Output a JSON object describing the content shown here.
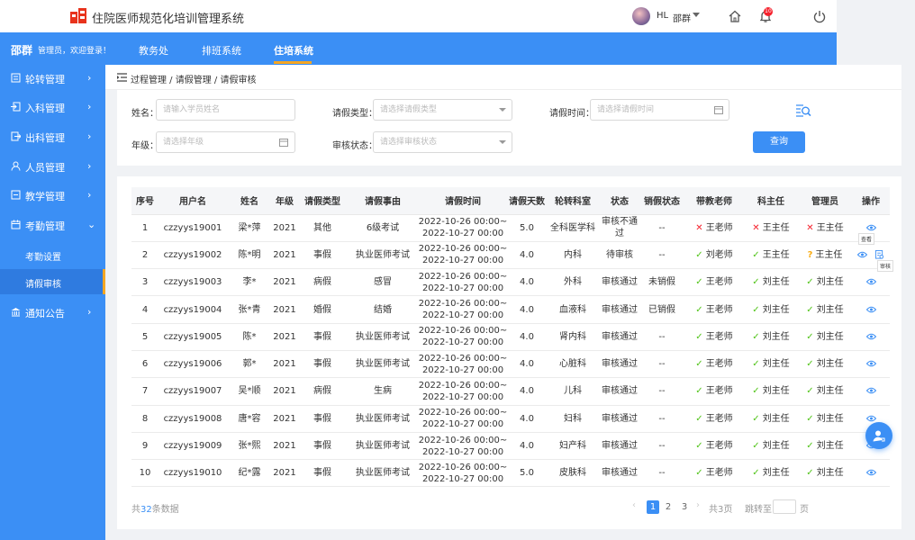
{
  "header": {
    "app_title": "住院医师规范化培训管理系统",
    "user_name": "HL",
    "user_role": "邵群",
    "notification_count": "10"
  },
  "navbar": {
    "user": "邵群",
    "welcome": "管理员，欢迎登录！",
    "items": [
      "教务处",
      "排班系统",
      "住培系统"
    ]
  },
  "sidebar": {
    "items": [
      "轮转管理",
      "入科管理",
      "出科管理",
      "人员管理",
      "教学管理",
      "考勤管理"
    ],
    "sub_items": [
      "考勤设置",
      "请假审核"
    ],
    "last_item": "通知公告"
  },
  "breadcrumb": "过程管理 / 请假管理 / 请假审核",
  "filters": {
    "name_label": "姓名：",
    "name_placeholder": "请输入学员姓名",
    "type_label": "请假类型：",
    "type_placeholder": "请选择请假类型",
    "time_label": "请假时间：",
    "time_placeholder": "请选择请假时间",
    "grade_label": "年级：",
    "grade_placeholder": "请选择年级",
    "status_label": "审核状态：",
    "status_placeholder": "请选择审核状态",
    "query_label": "查询"
  },
  "table": {
    "headers": [
      "序号",
      "用户名",
      "姓名",
      "年级",
      "请假类型",
      "请假事由",
      "请假时间",
      "请假天数",
      "轮转科室",
      "状态",
      "销假状态",
      "带教老师",
      "科主任",
      "管理员",
      "操作"
    ],
    "rows": [
      {
        "no": "1",
        "user": "czzyys19001",
        "name": "梁*萍",
        "grade": "2021",
        "type": "其他",
        "reason": "6级考试",
        "start": "2022-10-26 00:00~",
        "end": "2022-10-27 00:00",
        "days": "5.0",
        "dept": "全科医学科",
        "status": "审核不通过",
        "cancel": "--",
        "teacher": "王老师",
        "teacher_mark": "no",
        "director": "王主任",
        "director_mark": "no",
        "admin": "王主任",
        "admin_mark": "no"
      },
      {
        "no": "2",
        "user": "czzyys19002",
        "name": "陈*明",
        "grade": "2021",
        "type": "事假",
        "reason": "执业医师考试",
        "start": "2022-10-26 00:00~",
        "end": "2022-10-27 00:00",
        "days": "4.0",
        "dept": "内科",
        "status": "待审核",
        "cancel": "--",
        "teacher": "刘老师",
        "teacher_mark": "ok",
        "director": "王主任",
        "director_mark": "ok",
        "admin": "王主任",
        "admin_mark": "q"
      },
      {
        "no": "3",
        "user": "czzyys19003",
        "name": "李*",
        "grade": "2021",
        "type": "病假",
        "reason": "感冒",
        "start": "2022-10-26 00:00~",
        "end": "2022-10-27 00:00",
        "days": "4.0",
        "dept": "外科",
        "status": "审核通过",
        "cancel": "未销假",
        "teacher": "王老师",
        "teacher_mark": "ok",
        "director": "刘主任",
        "director_mark": "ok",
        "admin": "刘主任",
        "admin_mark": "ok"
      },
      {
        "no": "4",
        "user": "czzyys19004",
        "name": "张*青",
        "grade": "2021",
        "type": "婚假",
        "reason": "结婚",
        "start": "2022-10-26 00:00~",
        "end": "2022-10-27 00:00",
        "days": "4.0",
        "dept": "血液科",
        "status": "审核通过",
        "cancel": "已销假",
        "teacher": "王老师",
        "teacher_mark": "ok",
        "director": "刘主任",
        "director_mark": "ok",
        "admin": "刘主任",
        "admin_mark": "ok"
      },
      {
        "no": "5",
        "user": "czzyys19005",
        "name": "陈*",
        "grade": "2021",
        "type": "事假",
        "reason": "执业医师考试",
        "start": "2022-10-26 00:00~",
        "end": "2022-10-27 00:00",
        "days": "4.0",
        "dept": "肾内科",
        "status": "审核通过",
        "cancel": "--",
        "teacher": "王老师",
        "teacher_mark": "ok",
        "director": "刘主任",
        "director_mark": "ok",
        "admin": "刘主任",
        "admin_mark": "ok"
      },
      {
        "no": "6",
        "user": "czzyys19006",
        "name": "郭*",
        "grade": "2021",
        "type": "事假",
        "reason": "执业医师考试",
        "start": "2022-10-26 00:00~",
        "end": "2022-10-27 00:00",
        "days": "4.0",
        "dept": "心脏科",
        "status": "审核通过",
        "cancel": "--",
        "teacher": "王老师",
        "teacher_mark": "ok",
        "director": "刘主任",
        "director_mark": "ok",
        "admin": "刘主任",
        "admin_mark": "ok"
      },
      {
        "no": "7",
        "user": "czzyys19007",
        "name": "吴*顺",
        "grade": "2021",
        "type": "病假",
        "reason": "生病",
        "start": "2022-10-26 00:00~",
        "end": "2022-10-27 00:00",
        "days": "4.0",
        "dept": "儿科",
        "status": "审核通过",
        "cancel": "--",
        "teacher": "王老师",
        "teacher_mark": "ok",
        "director": "刘主任",
        "director_mark": "ok",
        "admin": "刘主任",
        "admin_mark": "ok"
      },
      {
        "no": "8",
        "user": "czzyys19008",
        "name": "唐*容",
        "grade": "2021",
        "type": "事假",
        "reason": "执业医师考试",
        "start": "2022-10-26 00:00~",
        "end": "2022-10-27 00:00",
        "days": "4.0",
        "dept": "妇科",
        "status": "审核通过",
        "cancel": "--",
        "teacher": "王老师",
        "teacher_mark": "ok",
        "director": "刘主任",
        "director_mark": "ok",
        "admin": "刘主任",
        "admin_mark": "ok"
      },
      {
        "no": "9",
        "user": "czzyys19009",
        "name": "张*熙",
        "grade": "2021",
        "type": "事假",
        "reason": "执业医师考试",
        "start": "2022-10-26 00:00~",
        "end": "2022-10-27 00:00",
        "days": "4.0",
        "dept": "妇产科",
        "status": "审核通过",
        "cancel": "--",
        "teacher": "王老师",
        "teacher_mark": "ok",
        "director": "刘主任",
        "director_mark": "ok",
        "admin": "刘主任",
        "admin_mark": "ok"
      },
      {
        "no": "10",
        "user": "czzyys19010",
        "name": "纪*露",
        "grade": "2021",
        "type": "事假",
        "reason": "执业医师考试",
        "start": "2022-10-26 00:00~",
        "end": "2022-10-27 00:00",
        "days": "5.0",
        "dept": "皮肤科",
        "status": "审核通过",
        "cancel": "--",
        "teacher": "王老师",
        "teacher_mark": "ok",
        "director": "刘主任",
        "director_mark": "ok",
        "admin": "刘主任",
        "admin_mark": "ok"
      }
    ],
    "tooltip_view": "查看",
    "tooltip_audit": "审核"
  },
  "pagination": {
    "total_prefix": "共",
    "total_count": "32",
    "total_suffix": "条数据",
    "pages": [
      "1",
      "2",
      "3"
    ],
    "total_pages": "共3页",
    "jump_label": "跳转至",
    "page_suffix": "页"
  },
  "colors": {
    "primary": "#3b8ff5",
    "accent": "#f5a623",
    "success": "#52c41a",
    "danger": "#f5222d",
    "warning": "#faad14"
  }
}
